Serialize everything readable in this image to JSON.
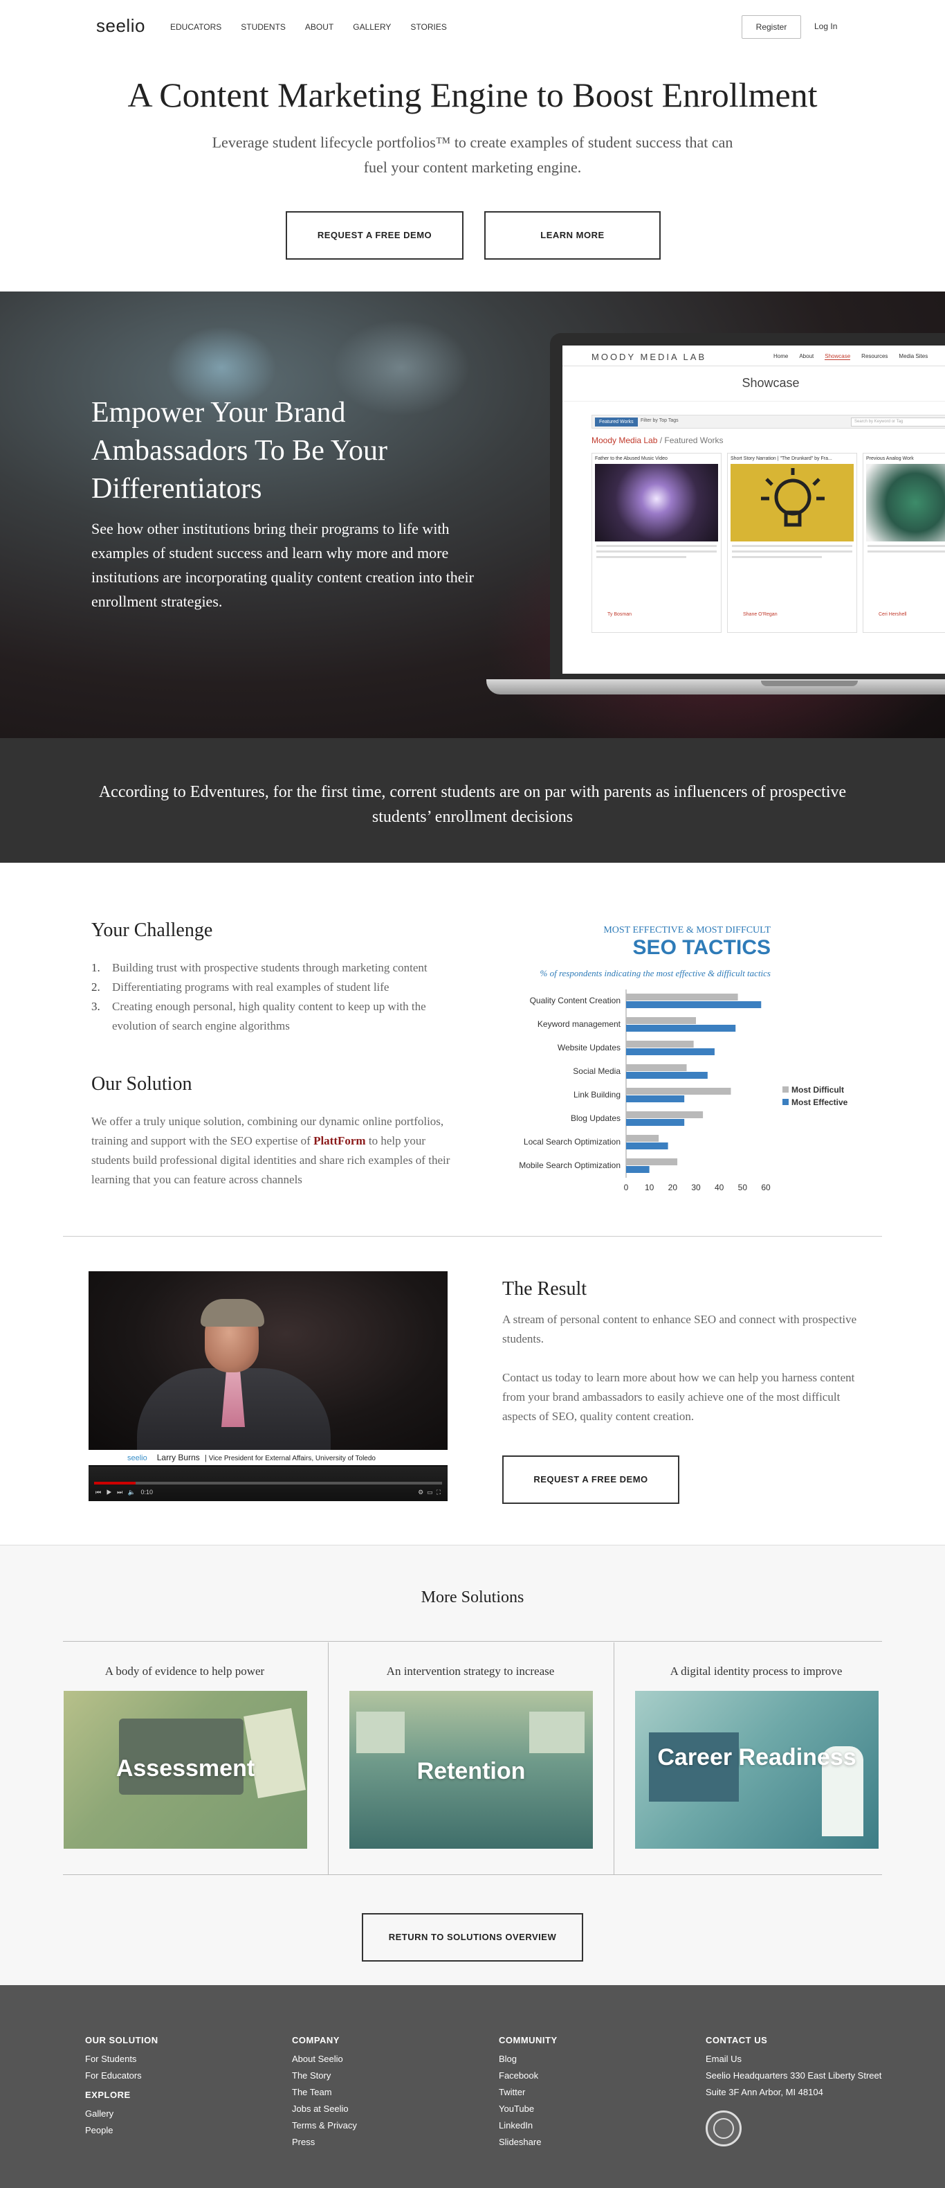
{
  "nav": {
    "logo": "seelio",
    "links": [
      "EDUCATORS",
      "STUDENTS",
      "ABOUT",
      "GALLERY",
      "STORIES"
    ],
    "register": "Register",
    "login": "Log In"
  },
  "hero": {
    "title": "A Content Marketing Engine to Boost Enrollment",
    "subtitle": "Leverage student lifecycle portfolios™ to create examples of student success that can fuel your content marketing engine.",
    "btn_demo": "REQUEST A FREE DEMO",
    "btn_learn": "LEARN MORE"
  },
  "banner": {
    "title": "Empower Your Brand Ambassadors To Be Your Differentiators",
    "body": "See how other institutions bring their programs to life with examples of student success and learn why more and more institutions are incorporating quality content creation into their enrollment strategies.",
    "screen": {
      "brand": "MOODY MEDIA LAB",
      "nav": [
        "Home",
        "About",
        "Showcase",
        "Resources",
        "Media Sites"
      ],
      "title": "Showcase",
      "tag": "Featured Works",
      "filter": "Filter by Top Tags",
      "search": "Search by Keyword or Tag",
      "crumb_a": "Moody Media Lab",
      "crumb_b": " / Featured Works",
      "cards": [
        {
          "title": "Father to the Abused Music Video",
          "author": "Ty Bosman"
        },
        {
          "title": "Short Story Narration | \"The Drunkard\" by Fra...",
          "author": "Shane O'Regan"
        },
        {
          "title": "Previous Analog Work",
          "author": "Ceri Hershell"
        }
      ]
    }
  },
  "quote": {
    "text": "According to Edventures, for the first time, corrent students are on par with parents as influencers of prospective students’ enrollment decisions"
  },
  "challenge": {
    "title": "Your Challenge",
    "items": [
      {
        "num": "1.",
        "text": "Building trust with prospective students through marketing content"
      },
      {
        "num": "2.",
        "text": "Differentiating programs with real examples of student life"
      },
      {
        "num": "3.",
        "text": "Creating enough personal, high quality content to keep up with the evolution of search engine algorithms"
      }
    ],
    "solution_title": "Our Solution",
    "solution_pre": "We offer a truly unique solution, combining our dynamic online portfolios, training and support with the SEO expertise of ",
    "solution_brand": "PlattForm",
    "solution_post": " to help your students build professional digital identities and share rich examples of their learning that you can feature across channels"
  },
  "chart_data": {
    "type": "bar",
    "kicker": "MOST EFFECTIVE & MOST DIFFCULT",
    "title": "SEO TACTICS",
    "subtitle": "% of respondents indicating the most effective & difficult tactics",
    "categories": [
      "Quality Content Creation",
      "Keyword management",
      "Website Updates",
      "Social Media",
      "Link Building",
      "Blog Updates",
      "Local Search Optimization",
      "Mobile Search Optimization"
    ],
    "series": [
      {
        "name": "Most Difficult",
        "values": [
          48,
          30,
          29,
          26,
          45,
          33,
          14,
          22
        ],
        "color": "#b9b9b9"
      },
      {
        "name": "Most Effective",
        "values": [
          58,
          47,
          38,
          35,
          25,
          25,
          18,
          10
        ],
        "color": "#3b7fc0"
      }
    ],
    "xlim": [
      0,
      60
    ],
    "xticks": [
      "0",
      "10",
      "20",
      "30",
      "40",
      "50",
      "60"
    ],
    "legend": "right",
    "orientation": "horizontal"
  },
  "result": {
    "title": "The Result",
    "p1": "A stream of personal content to enhance SEO and connect with prospective students.",
    "p2": "Contact us today to learn more about how we can help you harness content from your brand ambassadors to easily achieve one of the most difficult aspects of SEO, quality content creation.",
    "btn_demo": "REQUEST A FREE DEMO",
    "video": {
      "brand": "seelio",
      "name": "Larry Burns",
      "role": "Vice President for External Affairs, University of Toledo",
      "time": "0:10",
      "progress": 0.12
    }
  },
  "more": {
    "title": "More Solutions",
    "items": [
      {
        "caption": "A body of evidence to help power",
        "word": "Assessment"
      },
      {
        "caption": "An intervention strategy to increase",
        "word": "Retention"
      },
      {
        "caption": "A digital identity process to improve",
        "word": "Career Readiness"
      }
    ],
    "btn_return": "RETURN TO SOLUTIONS OVERVIEW"
  },
  "footer": {
    "solution_head": "OUR SOLUTION",
    "solution_links": [
      "For Students",
      "For Educators"
    ],
    "explore_head": "EXPLORE",
    "explore_links": [
      "Gallery",
      "People"
    ],
    "company_head": "COMPANY",
    "company_links": [
      "About Seelio",
      "The Story",
      "The Team",
      "Jobs at Seelio",
      "Terms & Privacy",
      "Press"
    ],
    "community_head": "COMMUNITY",
    "community_links": [
      "Blog",
      "Facebook",
      "Twitter",
      "YouTube",
      "LinkedIn",
      "Slideshare"
    ],
    "contact_head": "CONTACT US",
    "contact_email": "Email Us",
    "contact_addr1": "Seelio Headquarters 330 East Liberty Street",
    "contact_addr2": "Suite 3F Ann Arbor, MI 48104"
  }
}
